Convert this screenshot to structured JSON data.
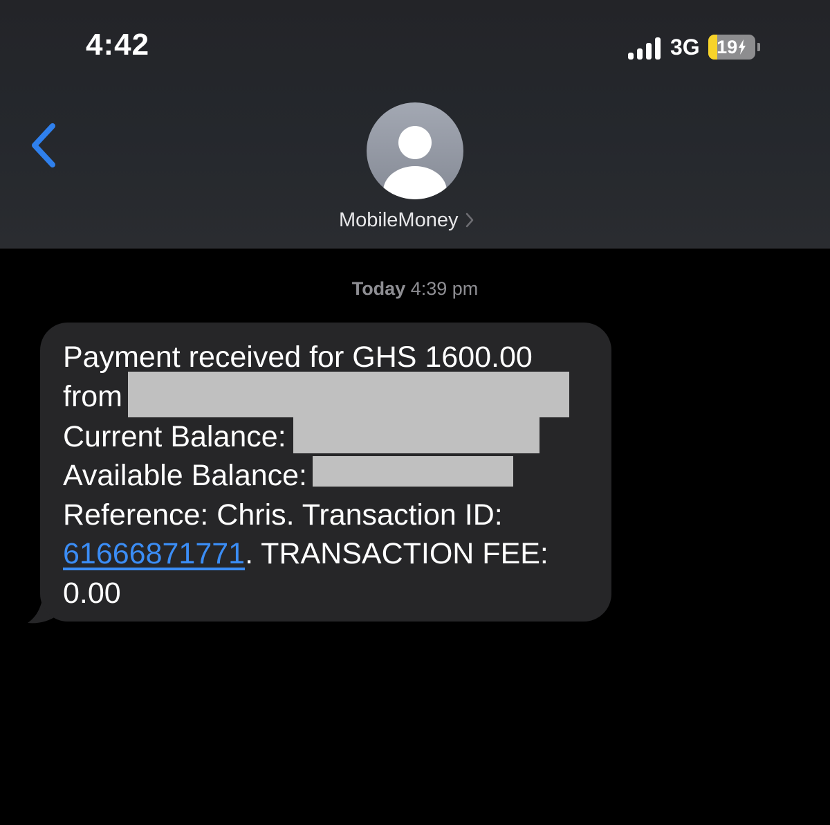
{
  "status_bar": {
    "time": "4:42",
    "network": "3G",
    "battery_level": "19",
    "battery_charging": true
  },
  "header": {
    "contact_name": "MobileMoney",
    "avatar_icon": "person-placeholder-icon",
    "back_icon": "chevron-left-icon"
  },
  "conversation": {
    "timestamp_day": "Today",
    "timestamp_time": "4:39 pm",
    "message": {
      "line1": "Payment received for GHS 1600.00",
      "line2_prefix": "from",
      "line3_prefix": "Current Balance:",
      "line4_prefix": "Available Balance:",
      "line5": "Reference: Chris. Transaction ID:",
      "transaction_id": "61666871771",
      "line6_suffix": ". TRANSACTION FEE:",
      "line7": "0.00"
    }
  },
  "colors": {
    "link": "#3b8df5",
    "bubble": "#262628",
    "back_chevron": "#2f80ed",
    "battery_fill": "#f7d32a"
  }
}
